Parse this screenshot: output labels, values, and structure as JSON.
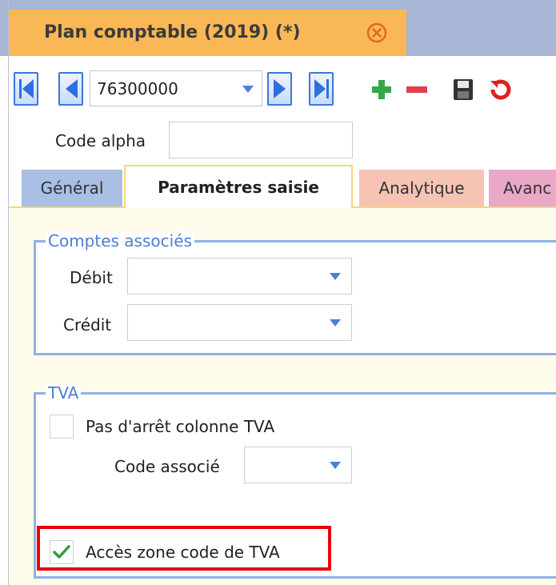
{
  "window": {
    "title": "Plan comptable (2019) (*)",
    "close_icon": "close-circle-icon"
  },
  "toolbar": {
    "record_value": "76300000",
    "first_icon": "first-record-icon",
    "prev_icon": "previous-record-icon",
    "next_icon": "next-record-icon",
    "last_icon": "last-record-icon",
    "add_icon": "plus-icon",
    "remove_icon": "minus-icon",
    "save_icon": "save-icon",
    "undo_icon": "undo-icon"
  },
  "fields": {
    "code_alpha_label": "Code alpha",
    "code_alpha_value": ""
  },
  "tabs": [
    {
      "label": "Général",
      "active": false
    },
    {
      "label": "Paramètres saisie",
      "active": true
    },
    {
      "label": "Analytique",
      "active": false
    },
    {
      "label": "Avanc",
      "active": false
    }
  ],
  "comptes": {
    "title": "Comptes associés",
    "debit_label": "Débit",
    "debit_value": "",
    "credit_label": "Crédit",
    "credit_value": ""
  },
  "tva": {
    "title": "TVA",
    "pas_arret_label": "Pas d'arrêt colonne TVA",
    "pas_arret_checked": false,
    "code_associe_label": "Code associé",
    "code_associe_value": "",
    "acces_zone_label": "Accès zone code de TVA",
    "acces_zone_checked": true
  },
  "colors": {
    "title_tab": "#f9b855",
    "titlebar": "#a6b6d4",
    "accent_blue": "#4d7ed4",
    "highlight_red": "#e8000f",
    "plus_green": "#34a845",
    "minus_red": "#e0404f"
  }
}
